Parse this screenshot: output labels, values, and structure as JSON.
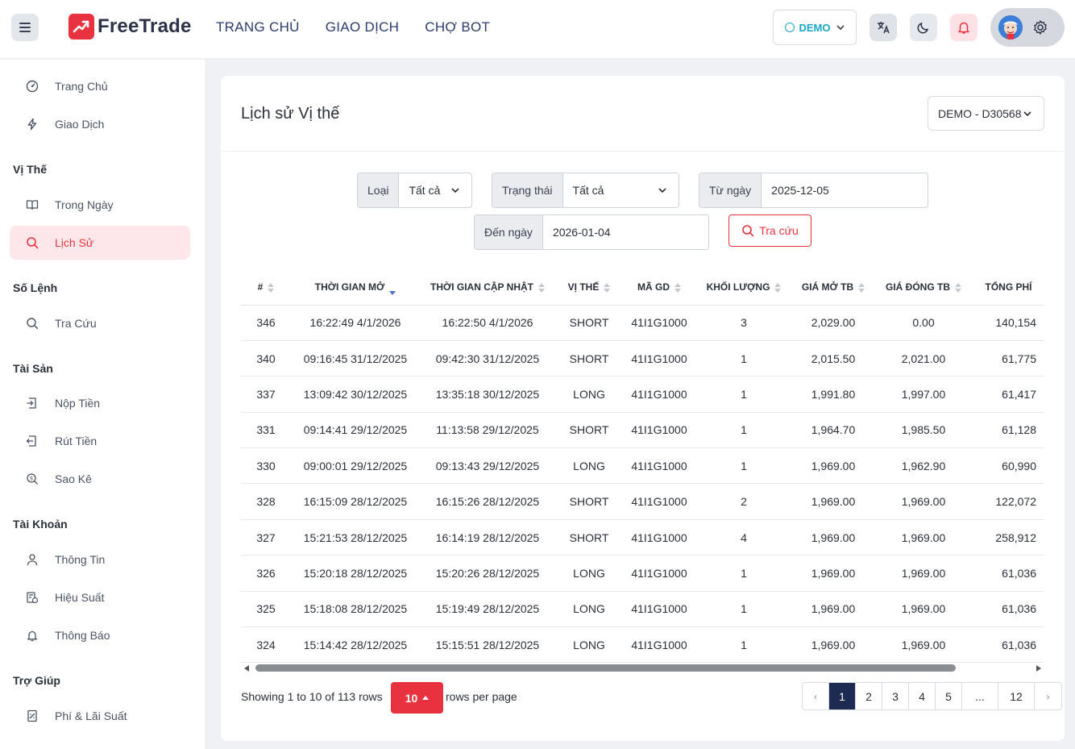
{
  "brand": {
    "name": "FreeTrade",
    "accent": "#e8323f"
  },
  "topnav": [
    "TRANG CHỦ",
    "GIAO DỊCH",
    "CHỢ BOT"
  ],
  "mode": {
    "label": "DEMO"
  },
  "sidebar": {
    "top_items": [
      {
        "label": "Trang Chủ",
        "icon": "dashboard-icon"
      },
      {
        "label": "Giao Dịch",
        "icon": "lightning-icon"
      }
    ],
    "sections": [
      {
        "title": "Vị Thế",
        "items": [
          {
            "label": "Trong Ngày",
            "icon": "book-icon"
          },
          {
            "label": "Lịch Sử",
            "icon": "search-icon",
            "active": true
          }
        ]
      },
      {
        "title": "Số Lệnh",
        "items": [
          {
            "label": "Tra Cứu",
            "icon": "search-icon"
          }
        ]
      },
      {
        "title": "Tài Sản",
        "items": [
          {
            "label": "Nộp Tiền",
            "icon": "deposit-icon"
          },
          {
            "label": "Rút Tiền",
            "icon": "withdraw-icon"
          },
          {
            "label": "Sao Kê",
            "icon": "statement-icon"
          }
        ]
      },
      {
        "title": "Tài Khoản",
        "items": [
          {
            "label": "Thông Tin",
            "icon": "user-icon"
          },
          {
            "label": "Hiệu Suất",
            "icon": "performance-icon"
          },
          {
            "label": "Thông Báo",
            "icon": "bell-icon"
          }
        ]
      },
      {
        "title": "Trợ Giúp",
        "items": [
          {
            "label": "Phí & Lãi Suất",
            "icon": "fee-icon"
          }
        ]
      }
    ]
  },
  "page": {
    "title": "Lịch sử Vị thế",
    "account": "DEMO - D30568"
  },
  "filters": {
    "type": {
      "label": "Loại",
      "value": "Tất cả"
    },
    "status": {
      "label": "Trạng thái",
      "value": "Tất cả"
    },
    "from": {
      "label": "Từ ngày",
      "value": "2025-12-05"
    },
    "to": {
      "label": "Đến ngày",
      "value": "2026-01-04"
    },
    "search_label": "Tra cứu"
  },
  "table": {
    "columns": [
      "#",
      "THỜI GIAN MỞ",
      "THỜI GIAN CẬP NHẬT",
      "VỊ THẾ",
      "MÃ GD",
      "KHỐI LƯỢNG",
      "GIÁ MỞ TB",
      "GIÁ ĐÓNG TB",
      "TỔNG PHÍ"
    ],
    "rows": [
      [
        "346",
        "16:22:49 4/1/2026",
        "16:22:50 4/1/2026",
        "SHORT",
        "41I1G1000",
        "3",
        "2,029.00",
        "0.00",
        "140,154"
      ],
      [
        "340",
        "09:16:45 31/12/2025",
        "09:42:30 31/12/2025",
        "SHORT",
        "41I1G1000",
        "1",
        "2,015.50",
        "2,021.00",
        "61,775"
      ],
      [
        "337",
        "13:09:42 30/12/2025",
        "13:35:18 30/12/2025",
        "LONG",
        "41I1G1000",
        "1",
        "1,991.80",
        "1,997.00",
        "61,417"
      ],
      [
        "331",
        "09:14:41 29/12/2025",
        "11:13:58 29/12/2025",
        "SHORT",
        "41I1G1000",
        "1",
        "1,964.70",
        "1,985.50",
        "61,128"
      ],
      [
        "330",
        "09:00:01 29/12/2025",
        "09:13:43 29/12/2025",
        "LONG",
        "41I1G1000",
        "1",
        "1,969.00",
        "1,962.90",
        "60,990"
      ],
      [
        "328",
        "16:15:09 28/12/2025",
        "16:15:26 28/12/2025",
        "SHORT",
        "41I1G1000",
        "2",
        "1,969.00",
        "1,969.00",
        "122,072"
      ],
      [
        "327",
        "15:21:53 28/12/2025",
        "16:14:19 28/12/2025",
        "SHORT",
        "41I1G1000",
        "4",
        "1,969.00",
        "1,969.00",
        "258,912"
      ],
      [
        "326",
        "15:20:18 28/12/2025",
        "15:20:26 28/12/2025",
        "LONG",
        "41I1G1000",
        "1",
        "1,969.00",
        "1,969.00",
        "61,036"
      ],
      [
        "325",
        "15:18:08 28/12/2025",
        "15:19:49 28/12/2025",
        "LONG",
        "41I1G1000",
        "1",
        "1,969.00",
        "1,969.00",
        "61,036"
      ],
      [
        "324",
        "15:14:42 28/12/2025",
        "15:15:51 28/12/2025",
        "LONG",
        "41I1G1000",
        "1",
        "1,969.00",
        "1,969.00",
        "61,036"
      ]
    ]
  },
  "footer": {
    "showing": "Showing 1 to 10 of 113 rows",
    "per_page": "10",
    "per_page_suffix": "rows per page",
    "pages": [
      "‹",
      "1",
      "2",
      "3",
      "4",
      "5",
      "...",
      "12",
      "›"
    ],
    "active_page": "1"
  }
}
